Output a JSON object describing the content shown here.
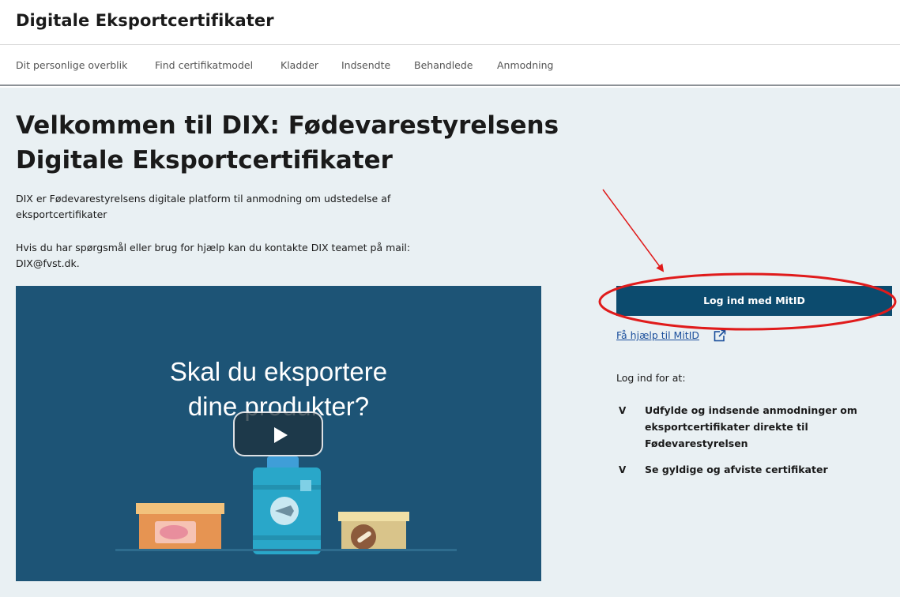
{
  "header": {
    "title": "Digitale Eksportcertifikater"
  },
  "nav": [
    {
      "label": "Dit personlige overblik"
    },
    {
      "label": "Find certifikatmodel"
    },
    {
      "label": "Kladder"
    },
    {
      "label": "Indsendte"
    },
    {
      "label": "Behandlede"
    },
    {
      "label": "Anmodning"
    }
  ],
  "main": {
    "heading_line1": "Velkommen til DIX: Fødevarestyrelsens",
    "heading_line2": "Digitale Eksportcertifikater",
    "intro_line1": "DIX er Fødevarestyrelsens digitale platform til anmodning om udstedelse af",
    "intro_line2": "eksportcertifikater",
    "contact_line1": "Hvis du har spørgsmål eller brug for hjælp kan du kontakte DIX teamet på mail:",
    "contact_line2": "DIX@fvst.dk."
  },
  "video": {
    "title_line1": "Skal du eksportere",
    "title_line2": "dine produkter?"
  },
  "login": {
    "button_label": "Log ind med MitID",
    "help_link": "Få hjælp til MitID",
    "login_for": "Log ind for at:",
    "check_symbol": "V",
    "benefits": [
      {
        "line1": "Udfylde og indsende anmodninger om",
        "line2": "eksportcertifikater direkte til",
        "line3": "Fødevarestyrelsen"
      },
      {
        "line1": "Se gyldige og afviste certifikater"
      }
    ]
  },
  "icons": {
    "external_link": "external-link-icon",
    "play": "play-icon"
  },
  "colors": {
    "accent": "#0c4b6e",
    "link": "#1b4f9c",
    "annotation": "#e01b1b",
    "page_background": "#e9f0f3",
    "video_background": "#1d5476"
  }
}
